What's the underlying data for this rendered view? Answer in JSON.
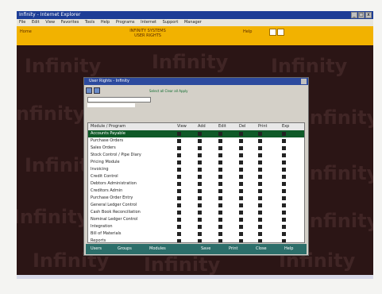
{
  "window": {
    "title": "Infinity - Internet Explorer"
  },
  "menu": {
    "items": [
      "File",
      "Edit",
      "View",
      "Favorites",
      "Tools",
      "Help",
      "Programs",
      "Internet",
      "Support",
      "Manager"
    ]
  },
  "topbar": {
    "home": "Home",
    "center_line1": "INFINITY SYSTEMS",
    "center_line2": "USER RIGHTS",
    "right": "Help"
  },
  "watermark": {
    "text": "Infinity"
  },
  "dialog": {
    "title": "User Rights - Infinity",
    "toolbar_link": "Select all  Clear all  Apply",
    "table": {
      "headers": [
        "Module / Program",
        "View",
        "Add",
        "Edit",
        "Del",
        "Print",
        "Exp"
      ],
      "rows": [
        "Accounts Payable",
        "Purchase Orders",
        "Sales Orders",
        "Stock Control / Pipe Diary",
        "Pricing Module",
        "Invoicing",
        "Credit Control",
        "Debtors Administration",
        "Creditors Admin",
        "Purchase Order Entry",
        "General Ledger Control",
        "Cash Book Reconciliation",
        "Nominal Ledger Control",
        "Integration",
        "Bill of Materials",
        "Reports"
      ]
    },
    "footer": {
      "items": [
        "Users",
        "Groups",
        "Modules",
        "Save",
        "Print",
        "Close",
        "Help"
      ]
    }
  }
}
